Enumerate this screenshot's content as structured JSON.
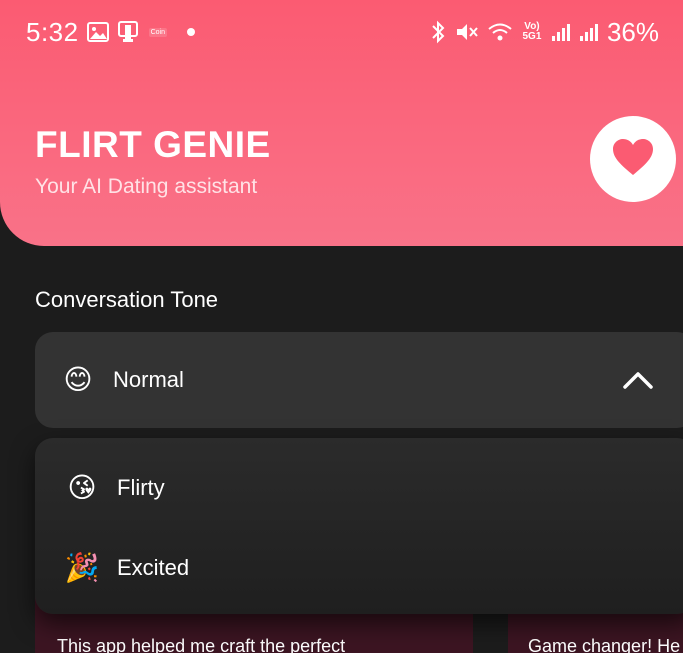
{
  "status_bar": {
    "time": "5:32",
    "battery": "36%",
    "coin_label": "Coin",
    "network_label": "Vo) 5G1"
  },
  "header": {
    "title": "FLIRT GENIE",
    "subtitle": "Your AI Dating assistant",
    "accent_color": "#fb5b72"
  },
  "tone": {
    "section_label": "Conversation Tone",
    "selected_label": "Normal",
    "selected_emoji": "😊",
    "options": [
      {
        "label": "Flirty",
        "emoji": "😘"
      },
      {
        "label": "Excited",
        "emoji": "🎉"
      }
    ]
  },
  "reviews": [
    {
      "text": "This app helped me craft the perfect"
    },
    {
      "text": "Game changer! He"
    }
  ]
}
